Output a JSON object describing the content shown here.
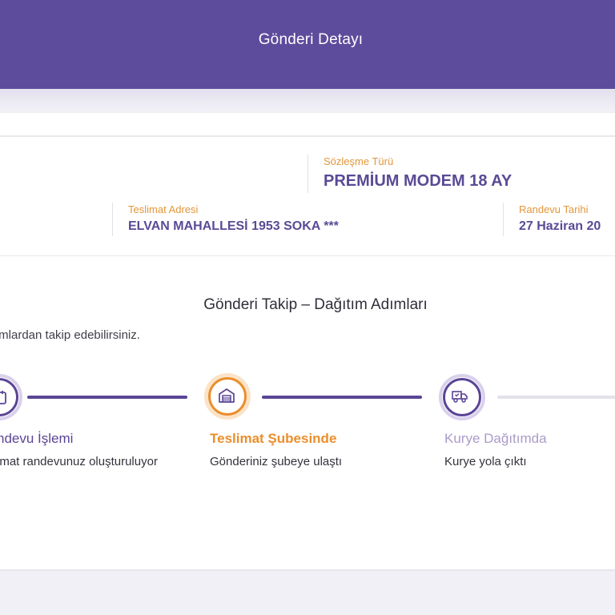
{
  "header": {
    "title": "Gönderi Detayı"
  },
  "info": {
    "contract_label": "Sözleşme Türü",
    "contract_value": "PREMİUM MODEM 18 AY",
    "address_label": "Teslimat Adresi",
    "address_value": "ELVAN MAHALLESİ 1953 SOKA ***",
    "date_label": "Randevu Tarihi",
    "date_value": "27 Haziran 20"
  },
  "tracking": {
    "title": "Gönderi Takip – Dağıtım Adımları",
    "subtitle": "ımlardan takip edebilirsiniz.",
    "steps": [
      {
        "title": "ndevu İşlemi",
        "desc": "imat randevunuz oluşturuluyor",
        "icon": "appointment-icon",
        "state": "done"
      },
      {
        "title": "Teslimat Şubesinde",
        "desc": "Gönderiniz şubeye ulaştı",
        "icon": "warehouse-icon",
        "state": "current"
      },
      {
        "title": "Kurye Dağıtımda",
        "desc": "Kurye yola çıktı",
        "icon": "delivery-truck-icon",
        "state": "pending"
      }
    ]
  },
  "colors": {
    "brand_purple": "#5d4b9c",
    "accent_orange": "#eb8e2c",
    "muted_purple": "#a99bc9"
  }
}
